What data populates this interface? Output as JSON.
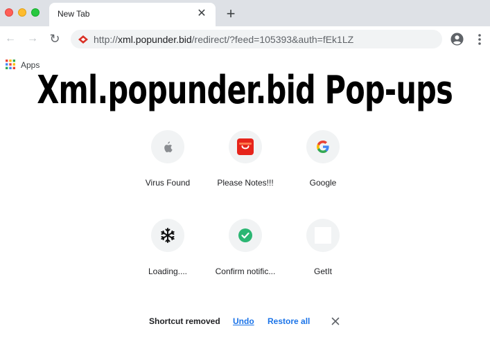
{
  "browser": {
    "tab": {
      "title": "New Tab",
      "close_glyph": "✕"
    },
    "new_tab_glyph": "+",
    "toolbar": {
      "back_glyph": "←",
      "forward_glyph": "→",
      "reload_glyph": "↻",
      "url": {
        "scheme": "http://",
        "host": "xml.popunder.bid",
        "rest": "/redirect/?feed=105393&auth=fEk1LZ"
      }
    },
    "bookmarks": {
      "apps_label": "Apps"
    }
  },
  "overlay": {
    "headline": "Xml.popunder.bid Pop-ups"
  },
  "shortcuts": [
    {
      "label": "Virus Found",
      "icon": "apple-icon"
    },
    {
      "label": "Please Notes!!!",
      "icon": "shopping-bag-icon"
    },
    {
      "label": "Google",
      "icon": "google-icon"
    },
    {
      "label": "Loading....",
      "icon": "snowflake-icon"
    },
    {
      "label": "Confirm notific...",
      "icon": "check-circle-icon"
    },
    {
      "label": "GetIt",
      "icon": "blank-square-icon"
    }
  ],
  "snackbar": {
    "message": "Shortcut removed",
    "undo_label": "Undo",
    "restore_label": "Restore all"
  },
  "colors": {
    "accent": "#1a73e8",
    "tabstrip": "#dee1e6",
    "omnibox": "#f1f3f4",
    "check_green": "#2bb673",
    "bag_red": "#e6241b"
  }
}
